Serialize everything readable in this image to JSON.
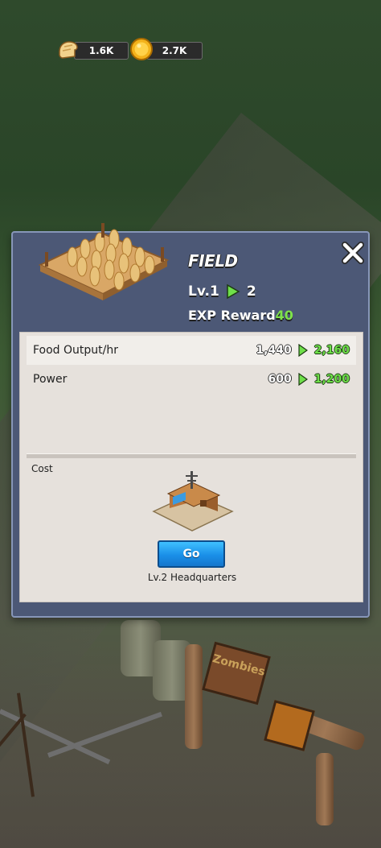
{
  "resources": {
    "food": {
      "value": "1.6K",
      "icon": "bread-icon"
    },
    "gold": {
      "value": "2.7K",
      "icon": "coin-icon"
    }
  },
  "building_panel": {
    "title": "FIELD",
    "level_current": "Lv.1",
    "level_next": "2",
    "exp_label": "EXP Reward",
    "exp_value": "40",
    "stats": [
      {
        "label": "Food Output/hr",
        "current": "1,440",
        "next": "2,160"
      },
      {
        "label": "Power",
        "current": "600",
        "next": "1,200"
      }
    ],
    "cost_label": "Cost",
    "requirement": {
      "button_label": "Go",
      "text": "Lv.2 Headquarters"
    }
  },
  "background_sign": "Zombies",
  "colors": {
    "panel_bg": "#4c5876",
    "inner_bg": "#e6e1dc",
    "upgrade_green": "#6fe04a",
    "go_button_blue": "#1a8fe8"
  }
}
